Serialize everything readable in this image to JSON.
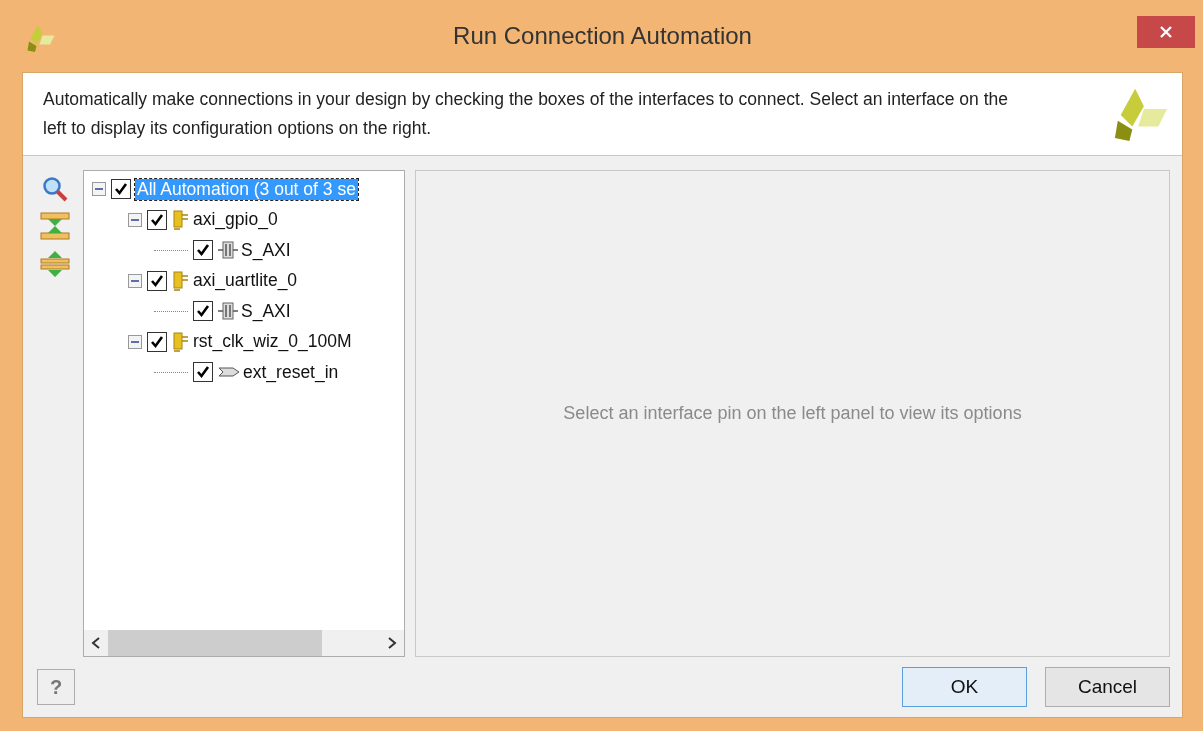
{
  "window": {
    "title": "Run Connection Automation"
  },
  "description": "Automatically make connections in your design by checking the boxes of the interfaces to connect. Select an interface on the left to display its configuration options on the right.",
  "tree": [
    {
      "label": "All Automation (3 out of 3 se",
      "checked": true,
      "selected": true,
      "expanded": true,
      "children": [
        {
          "label": "axi_gpio_0",
          "kind": "component",
          "checked": true,
          "selected": false,
          "expanded": true,
          "children": [
            {
              "label": "S_AXI",
              "kind": "interface",
              "checked": true,
              "selected": false
            }
          ]
        },
        {
          "label": "axi_uartlite_0",
          "kind": "component",
          "checked": true,
          "selected": false,
          "expanded": true,
          "children": [
            {
              "label": "S_AXI",
              "kind": "interface",
              "checked": true,
              "selected": false
            }
          ]
        },
        {
          "label": "rst_clk_wiz_0_100M",
          "kind": "component",
          "checked": true,
          "selected": false,
          "expanded": true,
          "children": [
            {
              "label": "ext_reset_in",
              "kind": "pin",
              "checked": true,
              "selected": false
            }
          ]
        }
      ]
    }
  ],
  "options_hint": "Select an interface pin on the left panel to view its options",
  "help_button": "?",
  "buttons": [
    {
      "label": "OK",
      "kind": "default"
    },
    {
      "label": "Cancel",
      "kind": "normal"
    }
  ]
}
